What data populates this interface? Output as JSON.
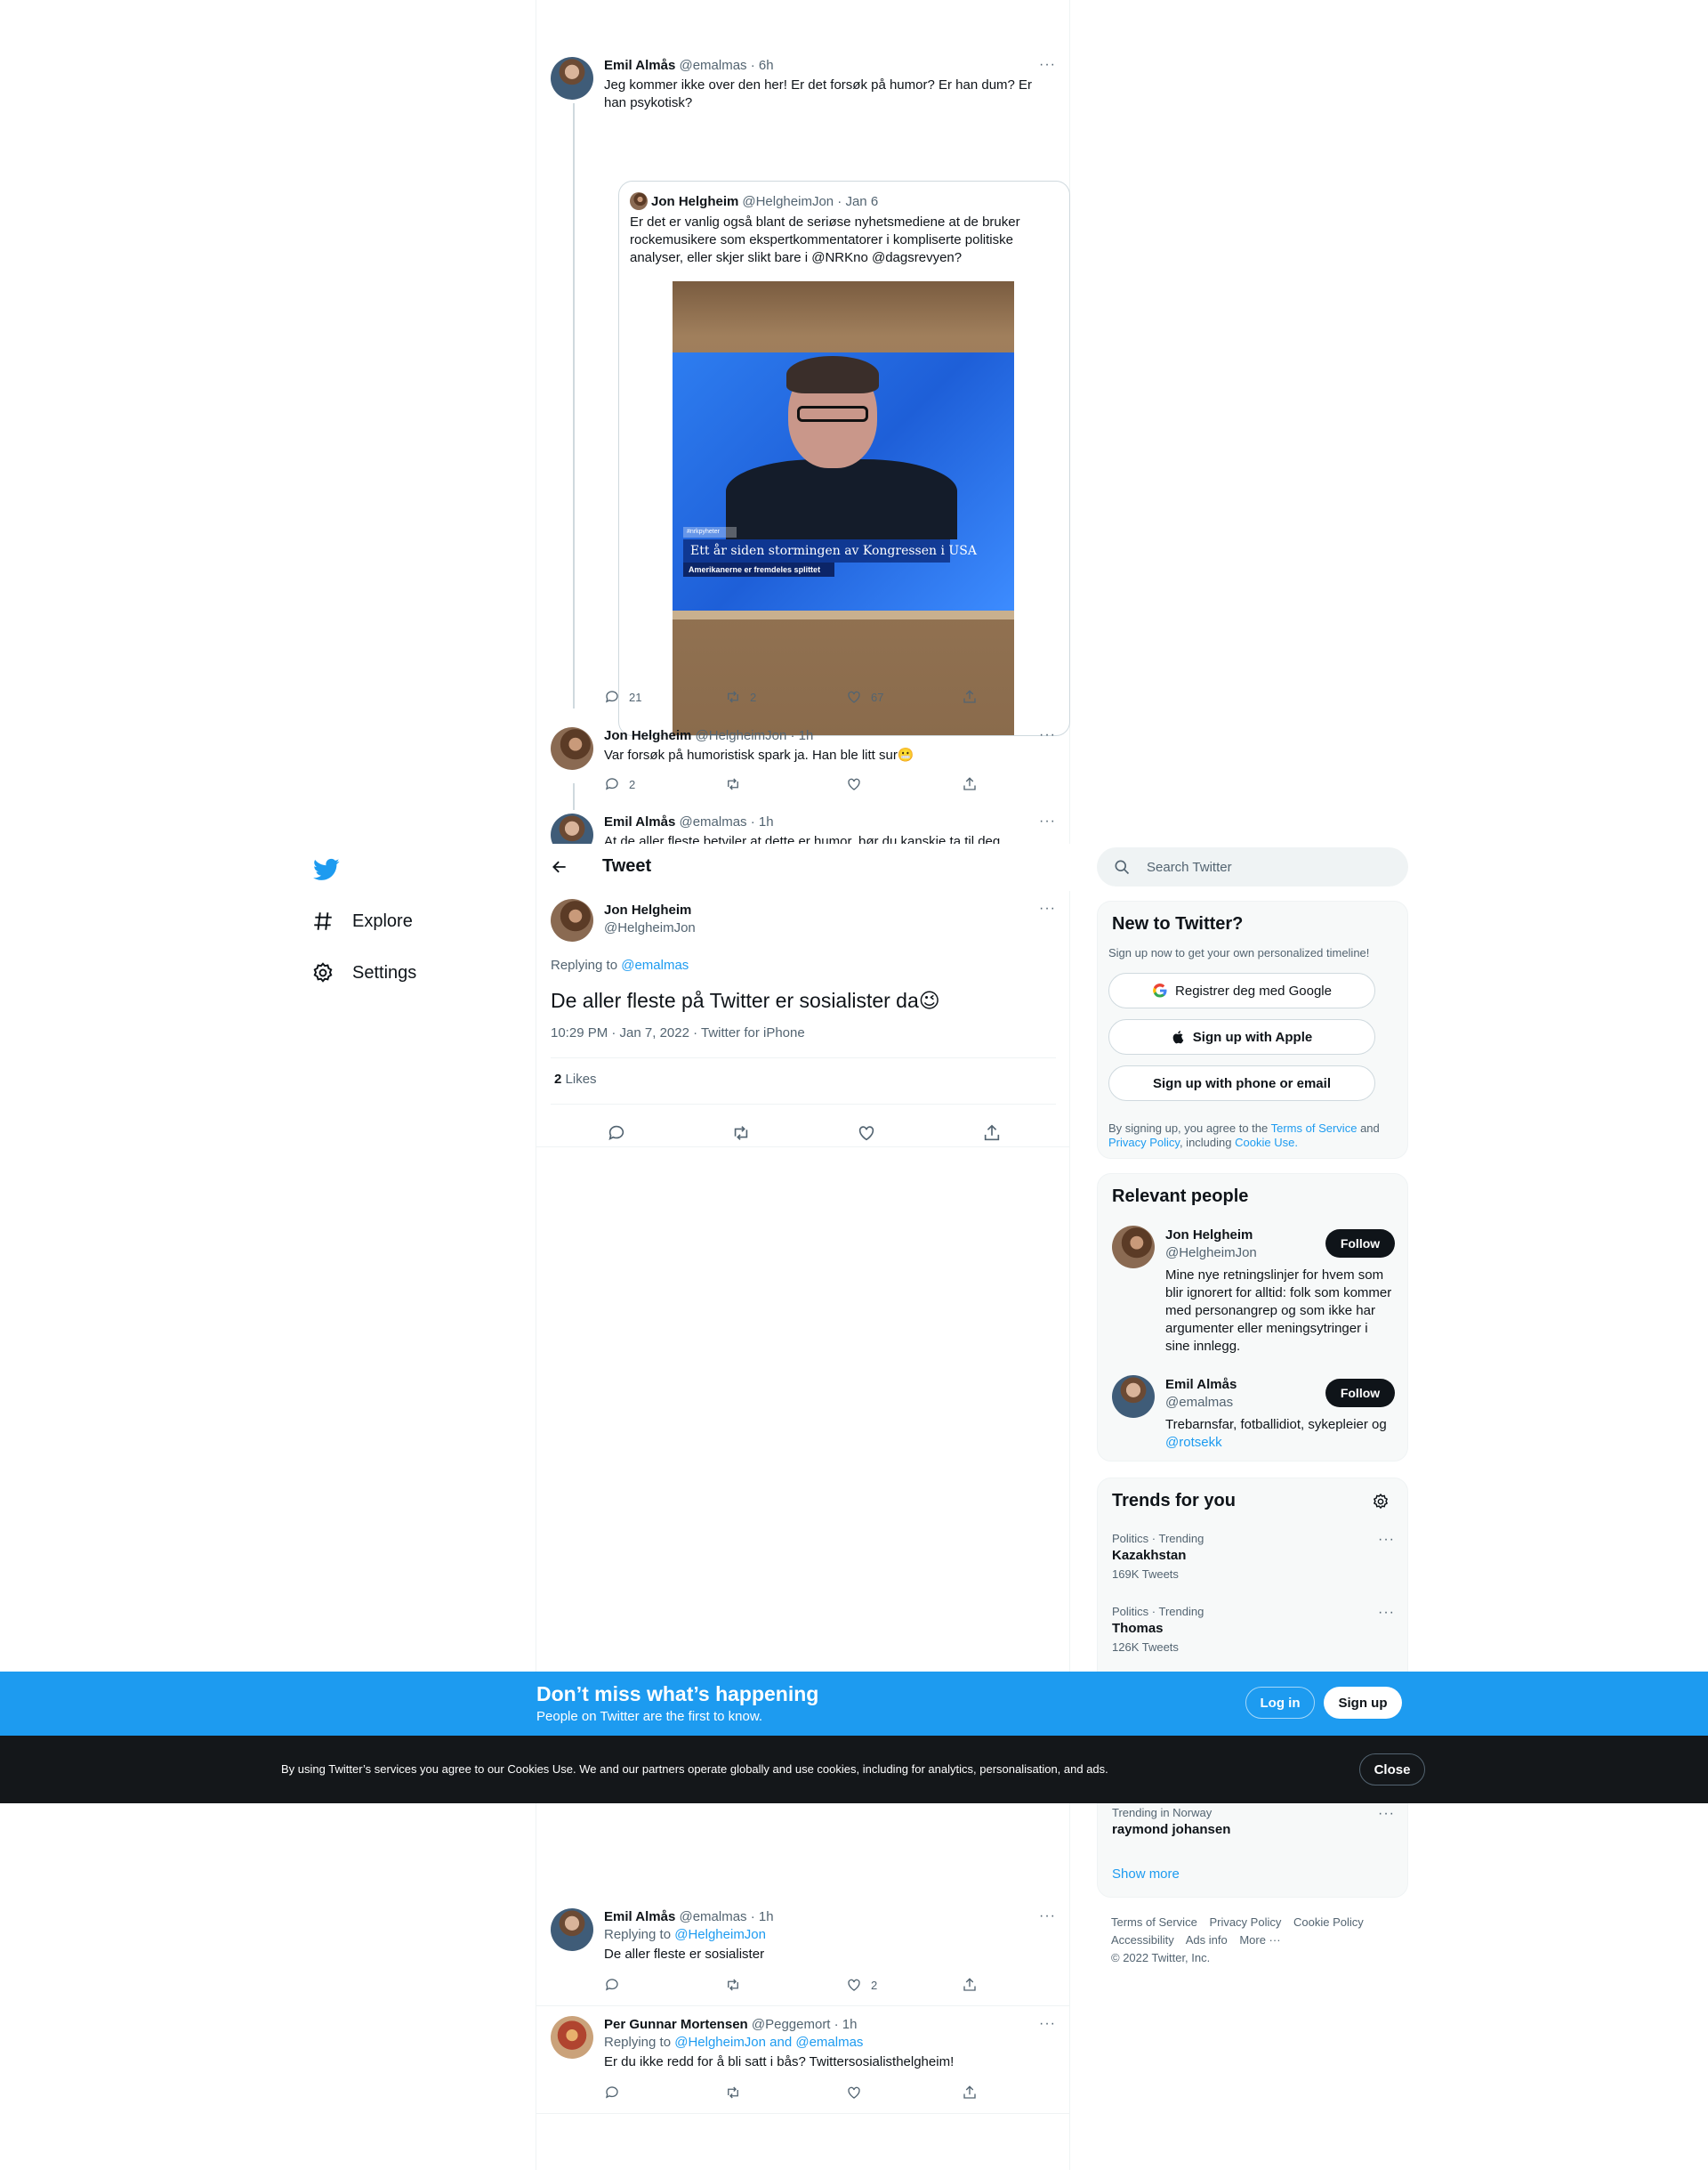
{
  "thread": {
    "tweet1": {
      "name": "Emil Almås",
      "handle": "@emalmas · 6h",
      "text": "Jeg kommer ikke over den her! Er det forsøk på humor? Er han dum? Er han psykotisk?",
      "quote": {
        "name": "Jon Helgheim",
        "handle": "@HelgheimJon · Jan 6",
        "text": "Er det er vanlig også blant de seriøse nyhetsmediene at de bruker rockemusikere som ekspertkommentatorer i kompliserte politiske analyser, eller skjer slikt bare i @NRKno @dagsrevyen?",
        "image": {
          "tag": "#nrkpyheter",
          "headline": "Ett år siden stormingen av Kongressen i USA",
          "subline": "Amerikanerne er fremdeles splittet"
        }
      },
      "replies": "21",
      "retweets": "2",
      "likes": "67"
    },
    "tweet2": {
      "name": "Jon Helgheim",
      "handle": "@HelgheimJon · 1h",
      "text": "Var forsøk på humoristisk spark ja. Han ble litt sur",
      "emoji": "😬",
      "replies": "2"
    },
    "tweet3": {
      "name": "Emil Almås",
      "handle": "@emalmas · 1h",
      "text": "At de aller fleste betviler at dette er humor, bør du kanskje ta til deg"
    }
  },
  "header": {
    "title": "Tweet"
  },
  "focus": {
    "name": "Jon Helgheim",
    "handle": "@HelgheimJon",
    "replying_label": "Replying to",
    "replying_to": "@emalmas",
    "text": "De aller fleste på Twitter er sosialister da",
    "emoji": "😉",
    "meta": "10:29 PM · Jan 7, 2022 · Twitter for iPhone",
    "likes_count": "2",
    "likes_label": "Likes"
  },
  "nav": {
    "explore": "Explore",
    "settings": "Settings"
  },
  "search": {
    "placeholder": "Search Twitter"
  },
  "new_to_twitter": {
    "title": "New to Twitter?",
    "subtitle": "Sign up now to get your own personalized timeline!",
    "google": "Registrer deg med Google",
    "apple": "Sign up with Apple",
    "phone": "Sign up with phone or email",
    "terms_pre": "By signing up, you agree to the",
    "terms_tos": "Terms of Service",
    "terms_and": "and",
    "terms_privacy": "Privacy Policy",
    "terms_including": ", including",
    "terms_cookie": "Cookie Use."
  },
  "relevant": {
    "title": "Relevant people",
    "people": [
      {
        "name": "Jon Helgheim",
        "handle": "@HelgheimJon",
        "bio": "Mine nye retningslinjer for hvem som blir ignorert for alltid: folk som kommer med personangrep og som ikke har argumenter eller meningsytringer i sine innlegg.",
        "follow": "Follow"
      },
      {
        "name": "Emil Almås",
        "handle": "@emalmas",
        "bio": "Trebarnsfar, fotballidiot, sykepleier og",
        "bio_link": "@rotsekk",
        "follow": "Follow"
      }
    ]
  },
  "trends": {
    "title": "Trends for you",
    "items": [
      {
        "meta": "Politics · Trending",
        "name": "Kazakhstan",
        "count": "169K Tweets"
      },
      {
        "meta": "Politics · Trending",
        "name": "Thomas",
        "count": "126K Tweets"
      },
      {
        "meta": "Trending in Norway",
        "name": "raymond johansen",
        "count": ""
      }
    ],
    "show_more": "Show more"
  },
  "footer": {
    "links": [
      "Terms of Service",
      "Privacy Policy",
      "Cookie Policy",
      "Accessibility",
      "Ads info",
      "More ···"
    ],
    "copyright": "© 2022 Twitter, Inc."
  },
  "replies_below": {
    "r1": {
      "name": "Emil Almås",
      "handle": "@emalmas · 1h",
      "replying_label": "Replying to",
      "replying_to": "@HelgheimJon",
      "text": "De aller fleste er sosialister",
      "likes": "2"
    },
    "r2": {
      "name": "Per Gunnar Mortensen",
      "handle": "@Peggemort · 1h",
      "replying_label": "Replying to",
      "replying_to": "@HelgheimJon and @emalmas",
      "text": "Er du ikke redd for å bli satt i bås? Twittersosialisthelgheim!"
    }
  },
  "banner": {
    "title": "Don’t miss what’s happening",
    "subtitle": "People on Twitter are the first to know.",
    "login": "Log in",
    "signup": "Sign up"
  },
  "cookie": {
    "text": "By using Twitter’s services you agree to our Cookies Use. We and our partners operate globally and use cookies, including for analytics, personalisation, and ads.",
    "close": "Close"
  },
  "colors": {
    "accent": "#1d9bf0",
    "text": "#0f1419",
    "muted": "#536471",
    "border": "#eff3f4"
  }
}
